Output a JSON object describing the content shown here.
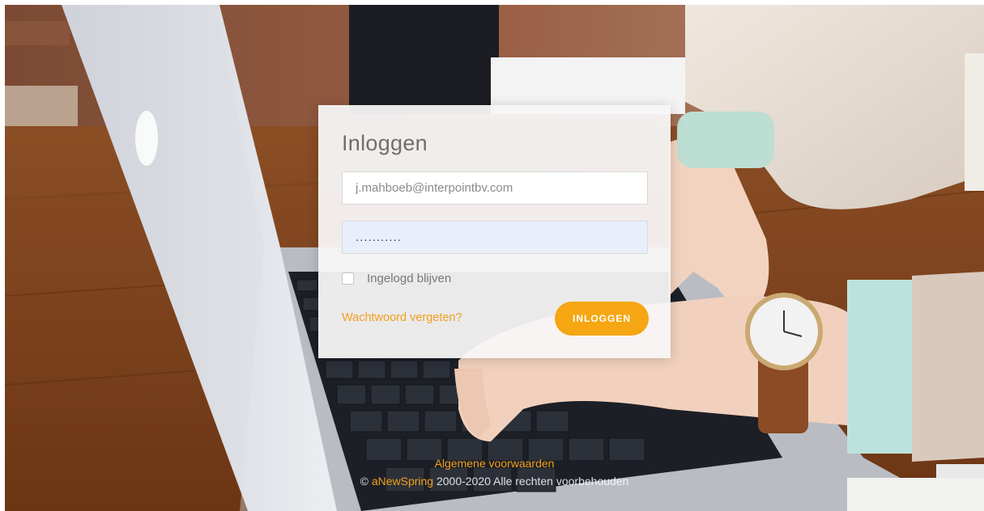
{
  "login": {
    "title": "Inloggen",
    "email_value": "j.mahboeb@interpointbv.com",
    "password_value": "...........",
    "remember_label": "Ingelogd blijven",
    "forgot_password": "Wachtwoord vergeten?",
    "submit_label": "INLOGGEN"
  },
  "footer": {
    "terms_link": "Algemene voorwaarden",
    "copyright_symbol": "©",
    "brand_link": "aNewSpring",
    "copyright_text": "2000-2020 Alle rechten voorbehouden"
  },
  "colors": {
    "accent": "#f5a612",
    "link": "#f0a01c",
    "card": "#f7f6f5",
    "password_bg": "#e8effb"
  }
}
